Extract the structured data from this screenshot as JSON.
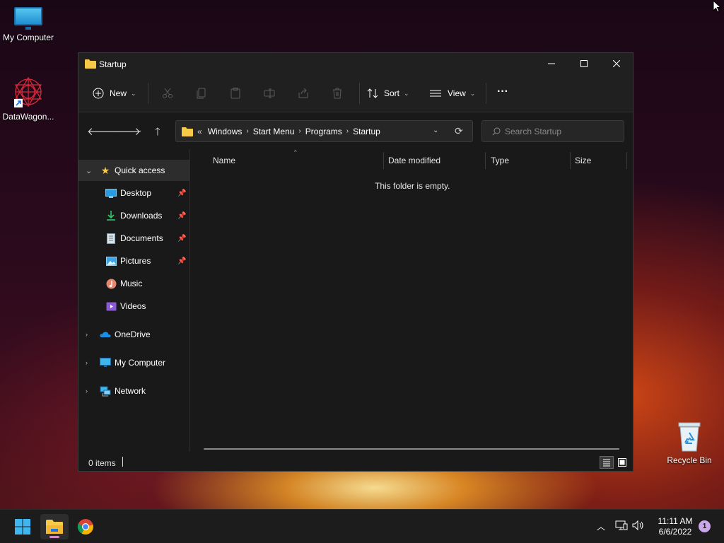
{
  "desktop": {
    "icons": [
      {
        "label": "My Computer"
      },
      {
        "label": "DataWagon..."
      },
      {
        "label": "Recycle Bin"
      }
    ]
  },
  "window": {
    "title": "Startup",
    "toolbar": {
      "new_label": "New",
      "sort_label": "Sort",
      "view_label": "View",
      "more_label": "···"
    },
    "breadcrumb": {
      "overflow": "«",
      "items": [
        "Windows",
        "Start Menu",
        "Programs",
        "Startup"
      ]
    },
    "search": {
      "placeholder": "Search Startup"
    },
    "nav": {
      "quick_access": "Quick access",
      "items": [
        {
          "label": "Desktop",
          "pinned": true
        },
        {
          "label": "Downloads",
          "pinned": true
        },
        {
          "label": "Documents",
          "pinned": true
        },
        {
          "label": "Pictures",
          "pinned": true
        },
        {
          "label": "Music",
          "pinned": false
        },
        {
          "label": "Videos",
          "pinned": false
        }
      ],
      "onedrive": "OneDrive",
      "my_computer": "My Computer",
      "network": "Network"
    },
    "columns": [
      "Name",
      "Date modified",
      "Type",
      "Size"
    ],
    "empty_message": "This folder is empty.",
    "status": {
      "count": "0 items"
    }
  },
  "taskbar": {
    "time": "11:11 AM",
    "date": "6/6/2022",
    "notification_count": "1"
  },
  "colors": {
    "window_bg": "#191919",
    "toolbar_bg": "#202020",
    "taskbar_bg": "#1c1c1c",
    "accent_folder": "#f7c948",
    "notif_badge": "#c9a7e8"
  }
}
